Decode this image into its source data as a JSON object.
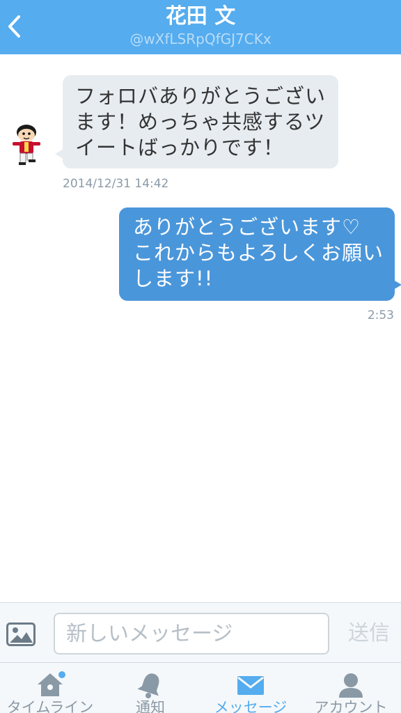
{
  "header": {
    "title": "花田 文",
    "handle": "@wXfLSRpQfGJ7CKx"
  },
  "messages": [
    {
      "direction": "incoming",
      "lines": [
        "フォロバありがとうござい",
        "ます！めっちゃ共感するツ",
        "イートばっかりです！"
      ],
      "timestamp": "2014/12/31 14:42"
    },
    {
      "direction": "outgoing",
      "lines": [
        "ありがとうございます♡",
        "これからもよろしくお願い",
        "します!!"
      ],
      "timestamp": "2:53"
    }
  ],
  "composer": {
    "placeholder": "新しいメッセージ",
    "send_label": "送信",
    "photo_icon": "photo-icon"
  },
  "tabs": [
    {
      "label": "タイムライン",
      "icon": "home-icon",
      "active": false,
      "badge": true
    },
    {
      "label": "通知",
      "icon": "bell-icon",
      "active": false
    },
    {
      "label": "メッセージ",
      "icon": "envelope-icon",
      "active": true
    },
    {
      "label": "アカウント",
      "icon": "person-icon",
      "active": false
    }
  ],
  "colors": {
    "accent": "#55acee",
    "incoming_bubble": "#e7ecf0",
    "outgoing_bubble": "#4a96da",
    "inactive_tab": "#8a99a6"
  }
}
